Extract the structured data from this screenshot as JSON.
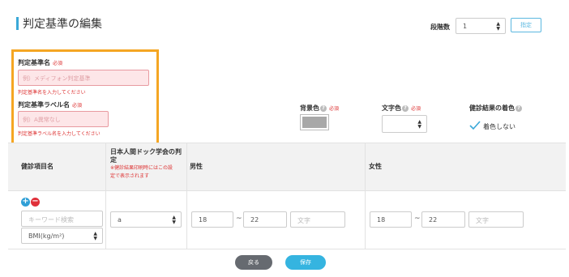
{
  "header": {
    "title": "判定基準の編集",
    "step_count_label": "段階数",
    "step_count_value": "1",
    "designate_button": "指定"
  },
  "name_section": {
    "criteria_name_label": "判定基準名",
    "criteria_name_required": "必須",
    "criteria_name_placeholder": "例）メディフォン判定基準",
    "criteria_name_error": "判定基準名を入力してください",
    "criteria_label_label": "判定基準ラベル名",
    "criteria_label_required": "必須",
    "criteria_label_placeholder": "例）A異常なし",
    "criteria_label_error": "判定基準ラベル名を入力してください"
  },
  "color_section": {
    "bg_color_label": "背景色",
    "bg_color_required": "必須",
    "bg_color_value": "#a8a8a8",
    "text_color_label": "文字色",
    "text_color_required": "必須",
    "result_color_label": "健診結果の着色",
    "no_color_label": "着色しない",
    "no_color_checked": true
  },
  "table": {
    "headers": {
      "item_name": "健診項目名",
      "jsa_line1": "日本人間ドック学会の判",
      "jsa_line2": "定",
      "jsa_note_line1": "※健診結果印刷時にはこの設",
      "jsa_note_line2": "定で表示されます",
      "male": "男性",
      "female": "女性"
    },
    "row": {
      "keyword_placeholder": "キーワード検索",
      "item_select": "BMI(kg/m²)",
      "jsa_select": "a",
      "male_min": "18",
      "male_max": "22",
      "male_text_placeholder": "文字",
      "female_min": "18",
      "female_max": "22",
      "female_text_placeholder": "文字",
      "range_sep": "~"
    }
  },
  "footer": {
    "back_button": "戻る",
    "save_button": "保存"
  },
  "icons": {
    "add": "+",
    "remove": "−",
    "help": "?",
    "select_arrows": "▲▼"
  }
}
